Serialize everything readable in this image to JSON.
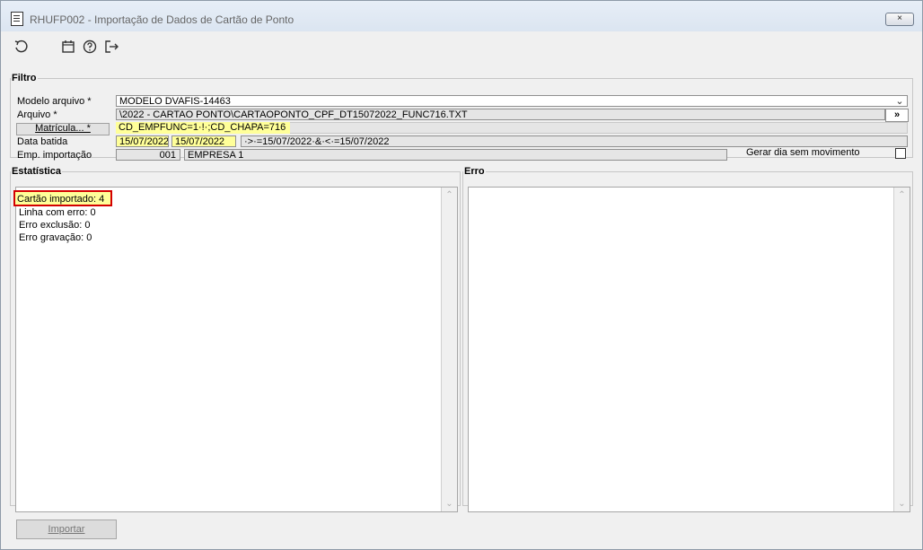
{
  "window": {
    "title": "RHUFP002 - Importação de Dados de Cartão de Ponto",
    "close_label": "×"
  },
  "toolbar": {
    "undo_icon": "undo-icon",
    "calendar_icon": "calendar-icon",
    "help_icon": "help-icon",
    "exit_icon": "exit-icon"
  },
  "filtro": {
    "legend": "Filtro",
    "modelo_label": "Modelo arquivo *",
    "modelo_value": "MODELO DVAFIS-14463",
    "arquivo_label": "Arquivo *",
    "arquivo_value": "\\2022 - CARTAO PONTO\\CARTAOPONTO_CPF_DT15072022_FUNC716.TXT",
    "arquivo_button": "»",
    "matricula_button": "Matrícula... *",
    "matricula_value": "CD_EMPFUNC=1·!·;CD_CHAPA=716",
    "data_label": "Data batida",
    "data_inicio": "15/07/2022",
    "data_fim": "15/07/2022",
    "data_expr": "·>·=15/07/2022·&·<·=15/07/2022",
    "emp_label": "Emp. importação",
    "emp_code": "001",
    "emp_name": "EMPRESA 1",
    "gerar_label": "Gerar dia sem movimento"
  },
  "estatistica": {
    "legend": "Estatística",
    "items": [
      "Cartão importado: 4",
      "Linha com erro: 0",
      "Erro exclusão: 0",
      "Erro gravação: 0"
    ]
  },
  "erro": {
    "legend": "Erro"
  },
  "actions": {
    "import_label": "Importar"
  }
}
